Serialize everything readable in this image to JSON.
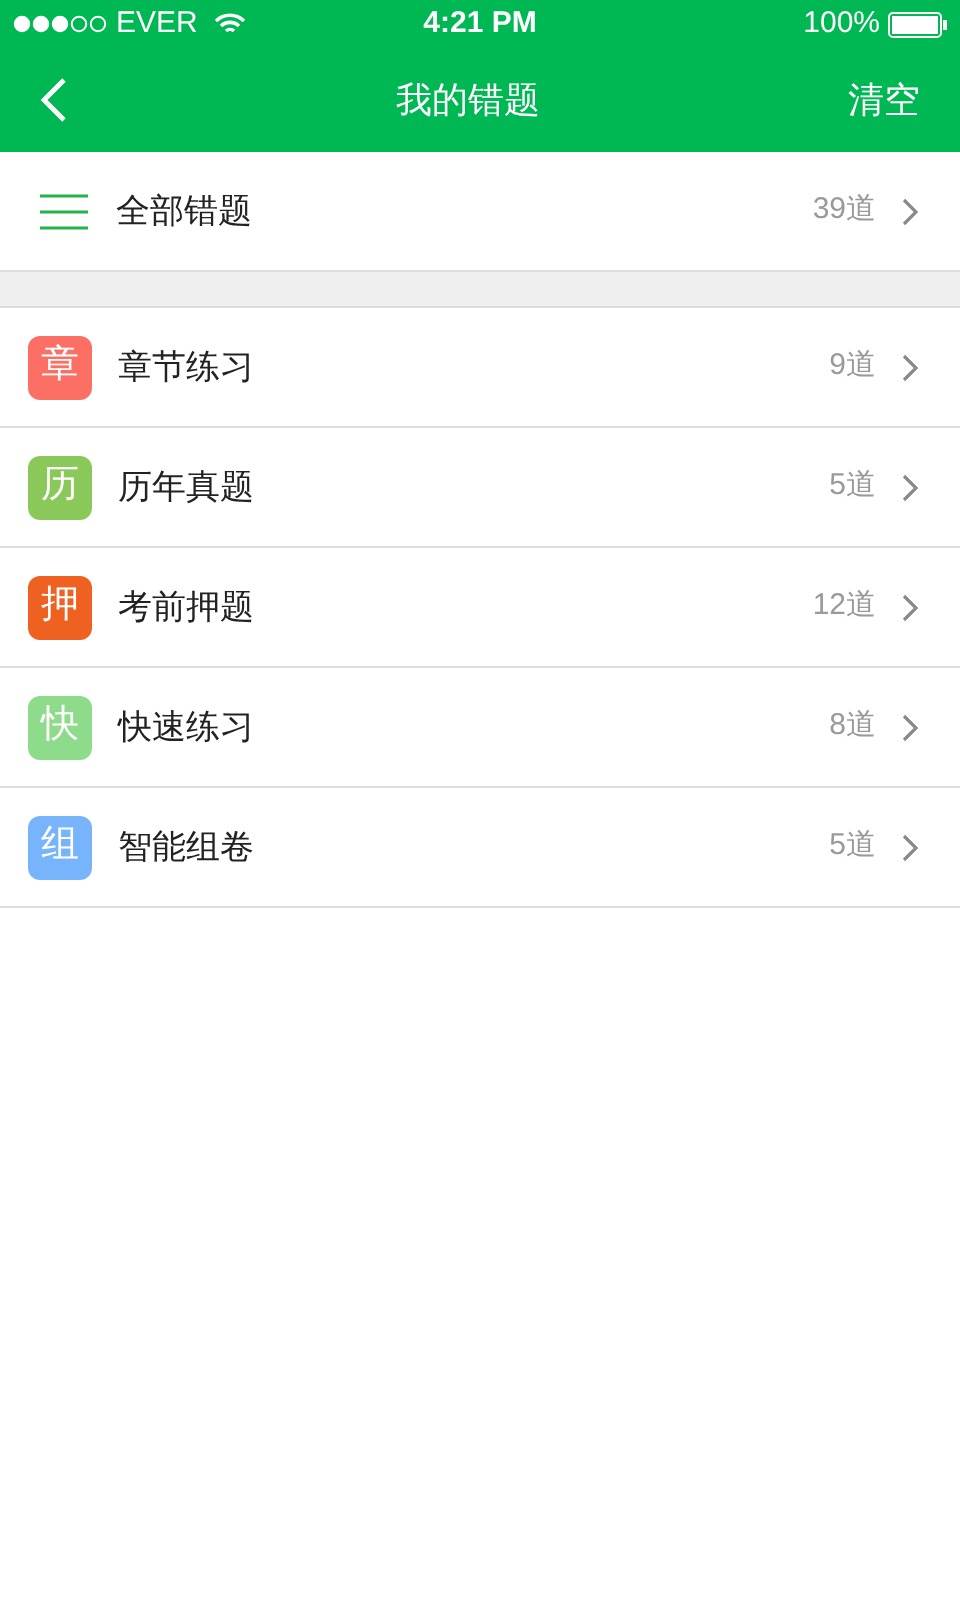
{
  "status_bar": {
    "carrier": "EVER",
    "time": "4:21 PM",
    "battery": "100%"
  },
  "nav": {
    "title": "我的错题",
    "action": "清空"
  },
  "all_item": {
    "label": "全部错题",
    "count": "39道"
  },
  "categories": [
    {
      "badge": "章",
      "label": "章节练习",
      "count": "9道",
      "color": "#fc6f64"
    },
    {
      "badge": "历",
      "label": "历年真题",
      "count": "5道",
      "color": "#8bc85a"
    },
    {
      "badge": "押",
      "label": "考前押题",
      "count": "12道",
      "color": "#ef6121"
    },
    {
      "badge": "快",
      "label": "快速练习",
      "count": "8道",
      "color": "#8fdb8c"
    },
    {
      "badge": "组",
      "label": "智能组卷",
      "count": "5道",
      "color": "#78b4fb"
    }
  ]
}
